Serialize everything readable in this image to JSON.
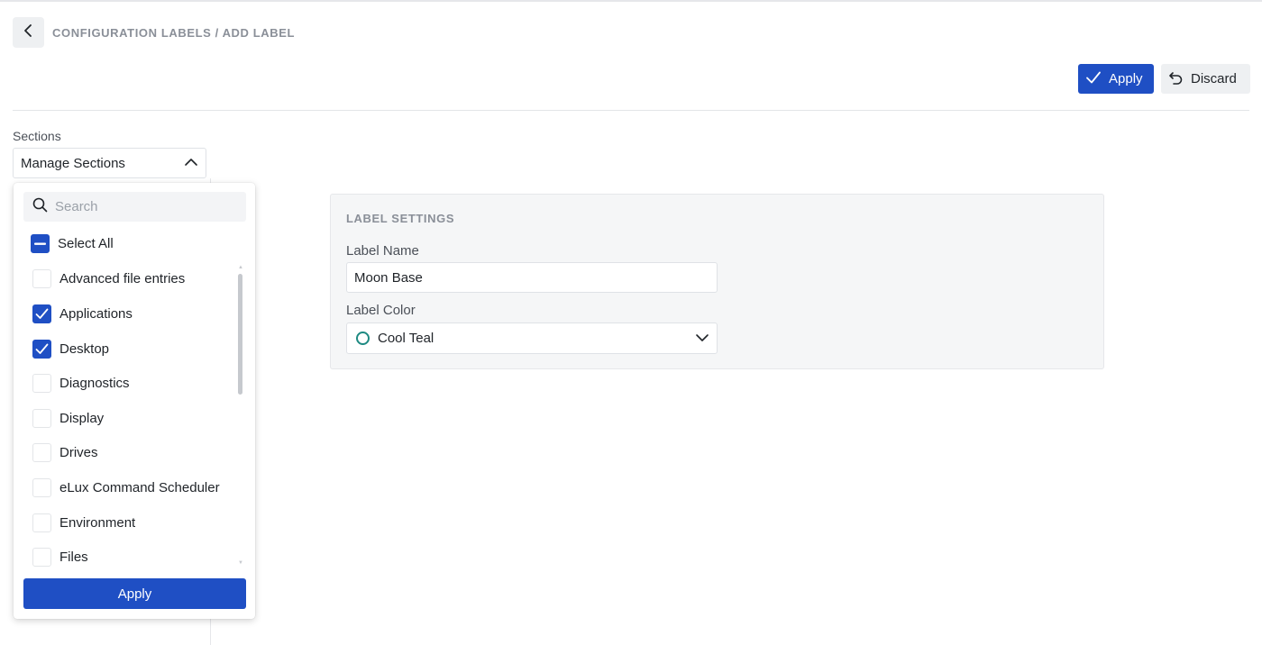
{
  "header": {
    "breadcrumb": "CONFIGURATION LABELS / ADD LABEL",
    "apply_label": "Apply",
    "discard_label": "Discard"
  },
  "sections": {
    "label": "Sections",
    "select_value": "Manage Sections",
    "dropdown": {
      "search_placeholder": "Search",
      "select_all_label": "Select All",
      "select_all_state": "partial",
      "items": [
        {
          "label": "Advanced file entries",
          "checked": false
        },
        {
          "label": "Applications",
          "checked": true
        },
        {
          "label": "Desktop",
          "checked": true
        },
        {
          "label": "Diagnostics",
          "checked": false
        },
        {
          "label": "Display",
          "checked": false
        },
        {
          "label": "Drives",
          "checked": false
        },
        {
          "label": "eLux Command Scheduler",
          "checked": false
        },
        {
          "label": "Environment",
          "checked": false
        },
        {
          "label": "Files",
          "checked": false
        }
      ],
      "apply_label": "Apply"
    }
  },
  "label_settings": {
    "title": "LABEL SETTINGS",
    "name_label": "Label Name",
    "name_value": "Moon Base",
    "color_label": "Label Color",
    "color_value": "Cool Teal",
    "color_hex": "#1e8a82"
  },
  "colors": {
    "primary": "#1f4fc4",
    "muted_text": "#8a8f98"
  }
}
